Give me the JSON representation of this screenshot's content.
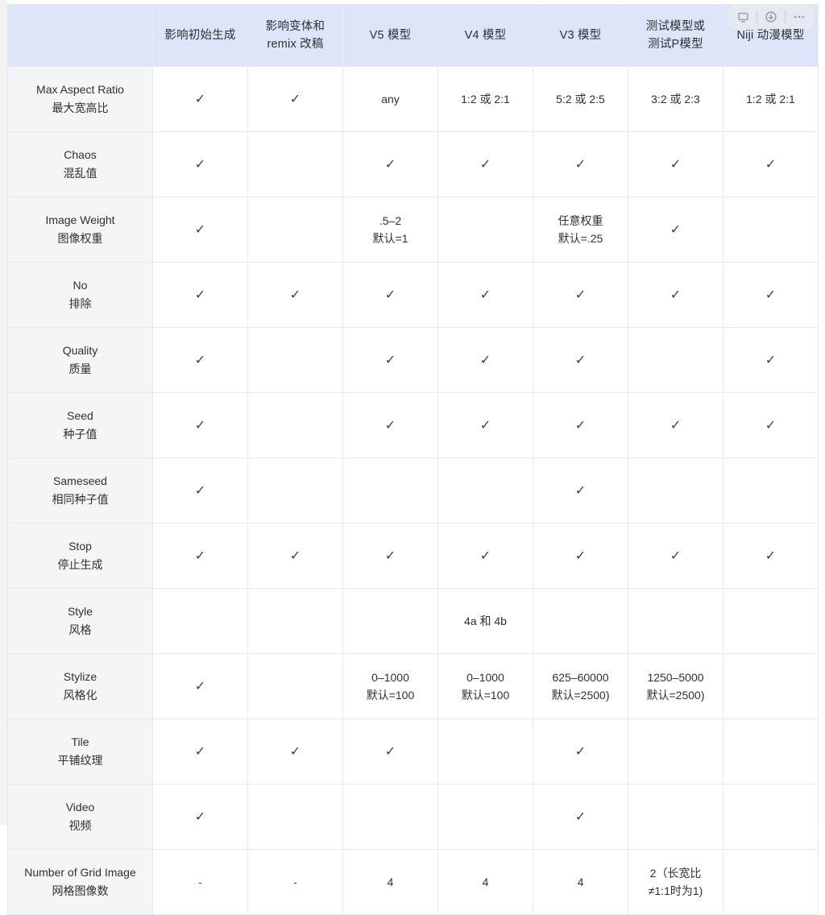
{
  "table": {
    "columns": [
      {
        "id": "param",
        "label_lines": [
          "",
          ""
        ]
      },
      {
        "id": "initial",
        "label_lines": [
          "影响初始生成",
          ""
        ]
      },
      {
        "id": "remix",
        "label_lines": [
          "影响变体和",
          "remix 改稿"
        ]
      },
      {
        "id": "v5",
        "label_lines": [
          "V5 模型",
          ""
        ]
      },
      {
        "id": "v4",
        "label_lines": [
          "V4 模型",
          ""
        ]
      },
      {
        "id": "v3",
        "label_lines": [
          "V3 模型",
          ""
        ]
      },
      {
        "id": "test",
        "label_lines": [
          "测试模型或",
          "测试P模型"
        ]
      },
      {
        "id": "niji",
        "label_lines": [
          "Niji 动漫模型",
          ""
        ]
      }
    ],
    "rows": [
      {
        "label_en": "Max Aspect Ratio",
        "label_zh": "最大宽高比",
        "cells": [
          {
            "type": "check",
            "text": "✓"
          },
          {
            "type": "check",
            "text": "✓"
          },
          {
            "type": "text",
            "lines": [
              "any"
            ]
          },
          {
            "type": "text",
            "lines": [
              "1:2 或 2:1"
            ]
          },
          {
            "type": "text",
            "lines": [
              "5:2 或 2:5"
            ]
          },
          {
            "type": "text",
            "lines": [
              "3:2 或 2:3"
            ]
          },
          {
            "type": "text",
            "lines": [
              "1:2 或 2:1"
            ]
          }
        ]
      },
      {
        "label_en": "Chaos",
        "label_zh": "混乱值",
        "cells": [
          {
            "type": "check",
            "text": "✓"
          },
          {
            "type": "empty",
            "lines": []
          },
          {
            "type": "check",
            "text": "✓"
          },
          {
            "type": "check",
            "text": "✓"
          },
          {
            "type": "check",
            "text": "✓"
          },
          {
            "type": "check",
            "text": "✓"
          },
          {
            "type": "check",
            "text": "✓"
          }
        ]
      },
      {
        "label_en": "Image Weight",
        "label_zh": "图像权重",
        "cells": [
          {
            "type": "check",
            "text": "✓"
          },
          {
            "type": "empty",
            "lines": []
          },
          {
            "type": "text",
            "lines": [
              ".5–2",
              "默认=1"
            ]
          },
          {
            "type": "empty",
            "lines": []
          },
          {
            "type": "text",
            "lines": [
              "任意权重",
              "默认=.25"
            ]
          },
          {
            "type": "check",
            "text": "✓"
          },
          {
            "type": "empty",
            "lines": []
          }
        ]
      },
      {
        "label_en": "No",
        "label_zh": "排除",
        "cells": [
          {
            "type": "check",
            "text": "✓"
          },
          {
            "type": "check",
            "text": "✓"
          },
          {
            "type": "check",
            "text": "✓"
          },
          {
            "type": "check",
            "text": "✓"
          },
          {
            "type": "check",
            "text": "✓"
          },
          {
            "type": "check",
            "text": "✓"
          },
          {
            "type": "check",
            "text": "✓"
          }
        ]
      },
      {
        "label_en": "Quality",
        "label_zh": "质量",
        "cells": [
          {
            "type": "check",
            "text": "✓"
          },
          {
            "type": "empty",
            "lines": []
          },
          {
            "type": "check",
            "text": "✓"
          },
          {
            "type": "check",
            "text": "✓"
          },
          {
            "type": "check",
            "text": "✓"
          },
          {
            "type": "empty",
            "lines": []
          },
          {
            "type": "check",
            "text": "✓"
          }
        ]
      },
      {
        "label_en": "Seed",
        "label_zh": "种子值",
        "cells": [
          {
            "type": "check",
            "text": "✓"
          },
          {
            "type": "empty",
            "lines": []
          },
          {
            "type": "check",
            "text": "✓"
          },
          {
            "type": "check",
            "text": "✓"
          },
          {
            "type": "check",
            "text": "✓"
          },
          {
            "type": "check",
            "text": "✓"
          },
          {
            "type": "check",
            "text": "✓"
          }
        ]
      },
      {
        "label_en": "Sameseed",
        "label_zh": "相同种子值",
        "cells": [
          {
            "type": "check",
            "text": "✓"
          },
          {
            "type": "empty",
            "lines": []
          },
          {
            "type": "empty",
            "lines": []
          },
          {
            "type": "empty",
            "lines": []
          },
          {
            "type": "check",
            "text": "✓"
          },
          {
            "type": "empty",
            "lines": []
          },
          {
            "type": "empty",
            "lines": []
          }
        ]
      },
      {
        "label_en": "Stop",
        "label_zh": "停止生成",
        "cells": [
          {
            "type": "check",
            "text": "✓"
          },
          {
            "type": "check",
            "text": "✓"
          },
          {
            "type": "check",
            "text": "✓"
          },
          {
            "type": "check",
            "text": "✓"
          },
          {
            "type": "check",
            "text": "✓"
          },
          {
            "type": "check",
            "text": "✓"
          },
          {
            "type": "check",
            "text": "✓"
          }
        ]
      },
      {
        "label_en": "Style",
        "label_zh": "风格",
        "cells": [
          {
            "type": "empty",
            "lines": []
          },
          {
            "type": "empty",
            "lines": []
          },
          {
            "type": "empty",
            "lines": []
          },
          {
            "type": "text",
            "lines": [
              "4a 和 4b"
            ]
          },
          {
            "type": "empty",
            "lines": []
          },
          {
            "type": "empty",
            "lines": []
          },
          {
            "type": "empty",
            "lines": []
          }
        ]
      },
      {
        "label_en": "Stylize",
        "label_zh": "风格化",
        "cells": [
          {
            "type": "check",
            "text": "✓"
          },
          {
            "type": "empty",
            "lines": []
          },
          {
            "type": "text",
            "lines": [
              "0–1000",
              "默认=100"
            ]
          },
          {
            "type": "text",
            "lines": [
              "0–1000",
              "默认=100"
            ]
          },
          {
            "type": "text",
            "lines": [
              "625–60000",
              "默认=2500)"
            ]
          },
          {
            "type": "text",
            "lines": [
              "1250–5000",
              "默认=2500)"
            ]
          },
          {
            "type": "empty",
            "lines": []
          }
        ]
      },
      {
        "label_en": "Tile",
        "label_zh": "平铺纹理",
        "cells": [
          {
            "type": "check",
            "text": "✓"
          },
          {
            "type": "check",
            "text": "✓"
          },
          {
            "type": "check",
            "text": "✓"
          },
          {
            "type": "empty",
            "lines": []
          },
          {
            "type": "check",
            "text": "✓"
          },
          {
            "type": "empty",
            "lines": []
          },
          {
            "type": "empty",
            "lines": []
          }
        ]
      },
      {
        "label_en": "Video",
        "label_zh": "视频",
        "cells": [
          {
            "type": "check",
            "text": "✓"
          },
          {
            "type": "empty",
            "lines": []
          },
          {
            "type": "empty",
            "lines": []
          },
          {
            "type": "empty",
            "lines": []
          },
          {
            "type": "check",
            "text": "✓"
          },
          {
            "type": "empty",
            "lines": []
          },
          {
            "type": "empty",
            "lines": []
          }
        ]
      },
      {
        "label_en": "Number of Grid Image",
        "label_zh": "网格图像数",
        "cells": [
          {
            "type": "dash",
            "text": "-"
          },
          {
            "type": "dash",
            "text": "-"
          },
          {
            "type": "text",
            "lines": [
              "4"
            ]
          },
          {
            "type": "text",
            "lines": [
              "4"
            ]
          },
          {
            "type": "text",
            "lines": [
              "4"
            ]
          },
          {
            "type": "text",
            "lines": [
              "2（长宽比",
              "≠1:1时为1)"
            ]
          },
          {
            "type": "empty",
            "lines": []
          }
        ]
      }
    ]
  },
  "overlay_toolbar": {
    "buttons": [
      {
        "id": "screenshot",
        "icon": "monitor-icon"
      },
      {
        "id": "download",
        "icon": "download-circle-icon"
      },
      {
        "id": "more",
        "icon": "more-horizontal-icon"
      }
    ]
  },
  "colors": {
    "header_bg": "#dee5f8",
    "label_bg": "#f4f5f6",
    "border": "#e8eaec",
    "text": "#2d3033",
    "scrollbar": "#d9dadc"
  }
}
